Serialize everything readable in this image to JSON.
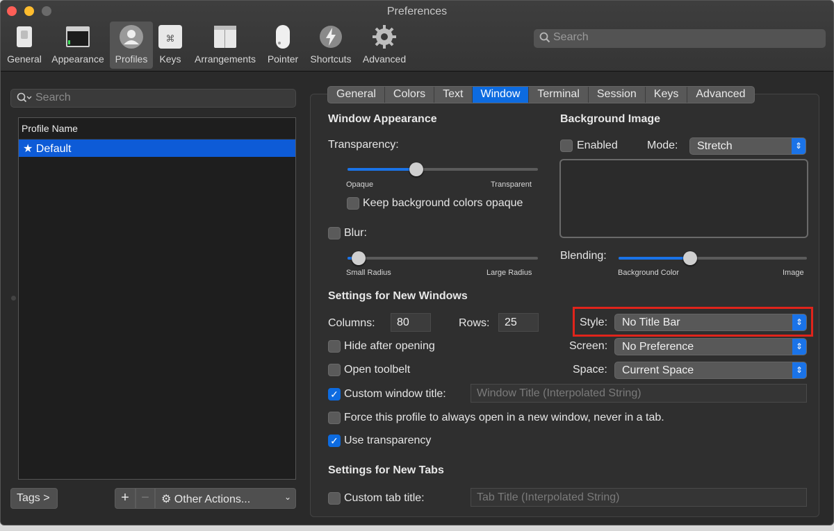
{
  "window": {
    "title": "Preferences",
    "traffic_colors": [
      "#fe5f57",
      "#febc2e",
      "#6a6a6a"
    ]
  },
  "toolbar": {
    "items": [
      {
        "label": "General",
        "icon": "general-switch-icon"
      },
      {
        "label": "Appearance",
        "icon": "appearance-window-icon"
      },
      {
        "label": "Profiles",
        "icon": "profiles-person-icon"
      },
      {
        "label": "Keys",
        "icon": "keys-command-icon"
      },
      {
        "label": "Arrangements",
        "icon": "arrangements-window-icon"
      },
      {
        "label": "Pointer",
        "icon": "pointer-mouse-icon"
      },
      {
        "label": "Shortcuts",
        "icon": "shortcuts-bolt-icon"
      },
      {
        "label": "Advanced",
        "icon": "advanced-gear-icon"
      }
    ],
    "selected": "Profiles",
    "search_placeholder": "Search"
  },
  "sidebar": {
    "search_placeholder": "Search",
    "column_header": "Profile Name",
    "profiles": [
      {
        "name": "Default",
        "default": true
      }
    ],
    "tags_button": "Tags >",
    "add_label": "+",
    "remove_label": "−",
    "other_actions": "Other Actions...",
    "accent": "#0d5bd7"
  },
  "tabs": {
    "items": [
      "General",
      "Colors",
      "Text",
      "Window",
      "Terminal",
      "Session",
      "Keys",
      "Advanced"
    ],
    "active": "Window"
  },
  "window_appearance": {
    "heading": "Window Appearance",
    "transparency_label": "Transparency:",
    "transparency_value": 0.36,
    "opaque_label": "Opaque",
    "transparent_label": "Transparent",
    "keep_bg_opaque_label": "Keep background colors opaque",
    "keep_bg_opaque_checked": false,
    "blur_label": "Blur:",
    "blur_checked": false,
    "blur_value": 0.06,
    "small_radius_label": "Small Radius",
    "large_radius_label": "Large Radius"
  },
  "background_image": {
    "heading": "Background Image",
    "enabled_label": "Enabled",
    "enabled_checked": false,
    "mode_label": "Mode:",
    "mode_value": "Stretch",
    "blending_label": "Blending:",
    "blending_value": 0.38,
    "bg_color_label": "Background Color",
    "image_label": "Image"
  },
  "new_windows": {
    "heading": "Settings for New Windows",
    "columns_label": "Columns:",
    "columns_value": "80",
    "rows_label": "Rows:",
    "rows_value": "25",
    "style_label": "Style:",
    "style_value": "No Title Bar",
    "screen_label": "Screen:",
    "screen_value": "No Preference",
    "space_label": "Space:",
    "space_value": "Current Space",
    "hide_after_opening_label": "Hide after opening",
    "hide_after_opening_checked": false,
    "open_toolbelt_label": "Open toolbelt",
    "open_toolbelt_checked": false,
    "custom_window_title_label": "Custom window title:",
    "custom_window_title_checked": true,
    "custom_window_title_placeholder": "Window Title (Interpolated String)",
    "force_new_window_label": "Force this profile to always open in a new window, never in a tab.",
    "force_new_window_checked": false,
    "use_transparency_label": "Use transparency",
    "use_transparency_checked": true
  },
  "new_tabs": {
    "heading": "Settings for New Tabs",
    "custom_tab_title_label": "Custom tab title:",
    "custom_tab_title_checked": false,
    "custom_tab_title_placeholder": "Tab Title (Interpolated String)"
  },
  "highlight_color": "#e0241b"
}
